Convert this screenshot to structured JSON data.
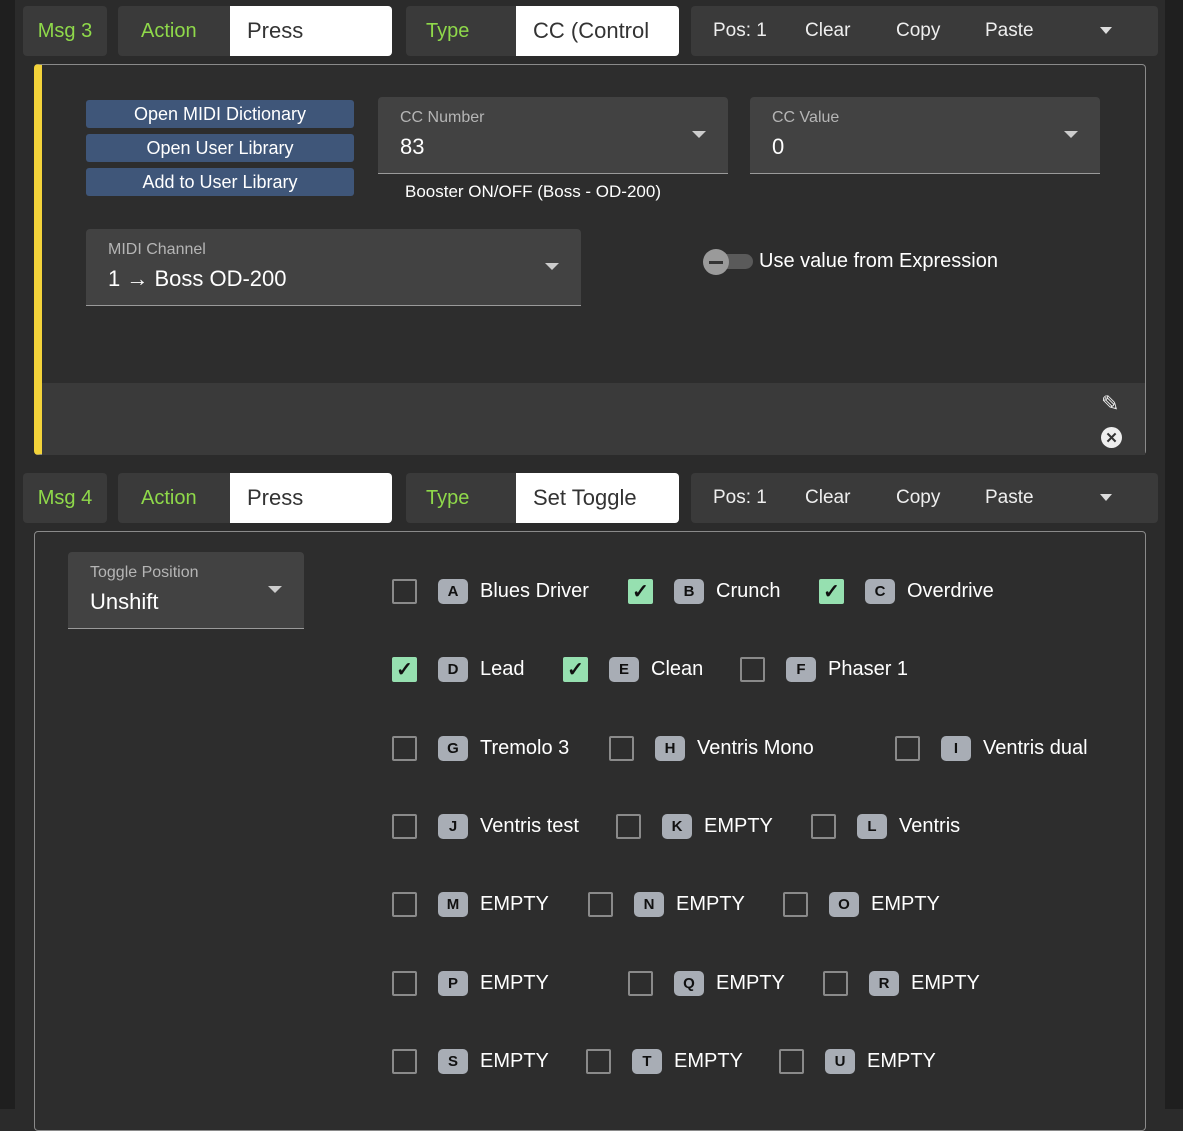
{
  "msg3": {
    "label": "Msg 3",
    "action_label": "Action",
    "action_value": "Press",
    "type_label": "Type",
    "type_value": "CC (Control",
    "pos": "Pos: 1",
    "clear": "Clear",
    "copy": "Copy",
    "paste": "Paste",
    "buttons": [
      "Open MIDI Dictionary",
      "Open User Library",
      "Add to User Library"
    ],
    "cc_number": {
      "label": "CC Number",
      "value": "83",
      "hint": "Booster ON/OFF (Boss - OD-200)"
    },
    "cc_value": {
      "label": "CC Value",
      "value": "0"
    },
    "midi_channel": {
      "label": "MIDI Channel",
      "value": "1 → Boss OD-200"
    },
    "expression_toggle": {
      "label": "Use value from Expression",
      "on": false
    }
  },
  "msg4": {
    "label": "Msg 4",
    "action_label": "Action",
    "action_value": "Press",
    "type_label": "Type",
    "type_value": "Set Toggle",
    "pos": "Pos: 1",
    "clear": "Clear",
    "copy": "Copy",
    "paste": "Paste",
    "toggle_position": {
      "label": "Toggle Position",
      "value": "Unshift"
    },
    "toggles": [
      {
        "key": "A",
        "name": "Blues Driver",
        "checked": false
      },
      {
        "key": "B",
        "name": "Crunch",
        "checked": true
      },
      {
        "key": "C",
        "name": "Overdrive",
        "checked": true
      },
      {
        "key": "D",
        "name": "Lead",
        "checked": true
      },
      {
        "key": "E",
        "name": "Clean",
        "checked": true
      },
      {
        "key": "F",
        "name": "Phaser 1",
        "checked": false
      },
      {
        "key": "G",
        "name": "Tremolo 3",
        "checked": false
      },
      {
        "key": "H",
        "name": "Ventris Mono",
        "checked": false
      },
      {
        "key": "I",
        "name": "Ventris dual",
        "checked": false
      },
      {
        "key": "J",
        "name": "Ventris test",
        "checked": false
      },
      {
        "key": "K",
        "name": "EMPTY",
        "checked": false
      },
      {
        "key": "L",
        "name": "Ventris",
        "checked": false
      },
      {
        "key": "M",
        "name": "EMPTY",
        "checked": false
      },
      {
        "key": "N",
        "name": "EMPTY",
        "checked": false
      },
      {
        "key": "O",
        "name": "EMPTY",
        "checked": false
      },
      {
        "key": "P",
        "name": "EMPTY",
        "checked": false
      },
      {
        "key": "Q",
        "name": "EMPTY",
        "checked": false
      },
      {
        "key": "R",
        "name": "EMPTY",
        "checked": false
      },
      {
        "key": "S",
        "name": "EMPTY",
        "checked": false
      },
      {
        "key": "T",
        "name": "EMPTY",
        "checked": false
      },
      {
        "key": "U",
        "name": "EMPTY",
        "checked": false
      }
    ]
  },
  "colors": {
    "accent_green": "#8fd94a",
    "button_blue": "#3f5679",
    "yellow_bar": "#f3d33a",
    "check_green": "#96e0b0"
  }
}
